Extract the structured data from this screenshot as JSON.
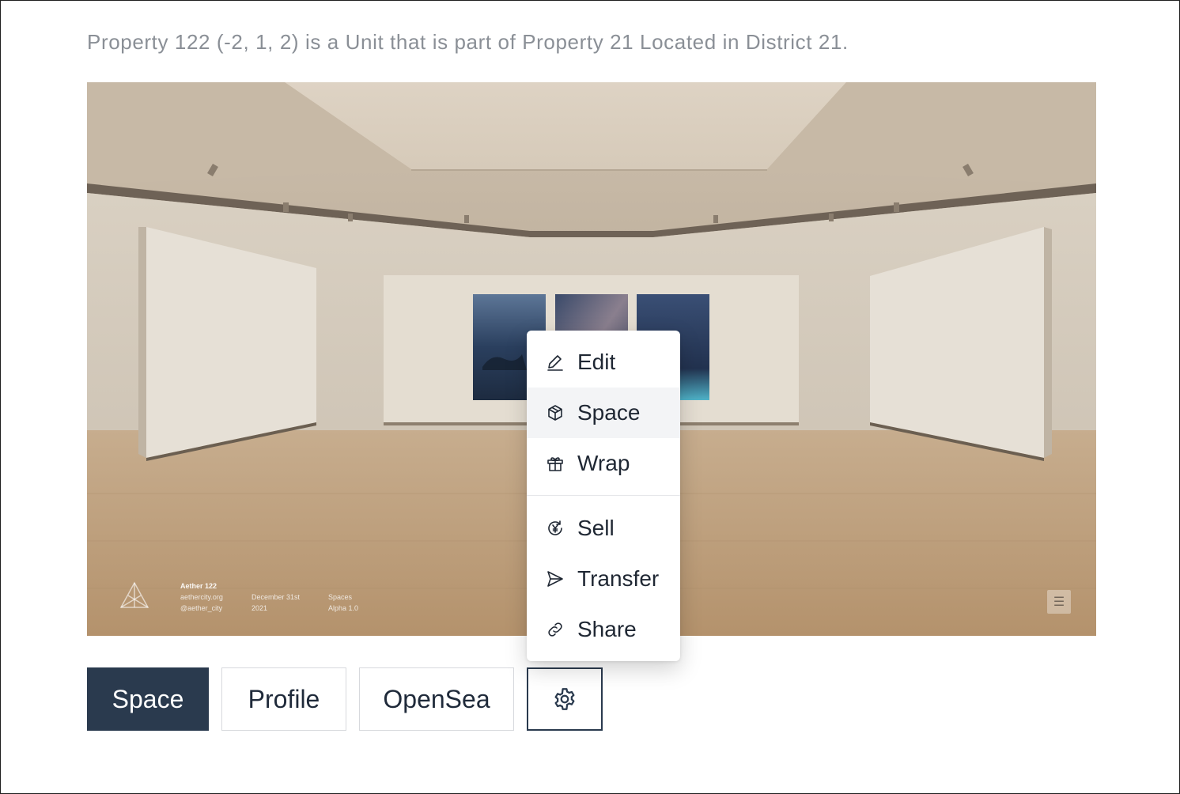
{
  "description": "Property 122 (-2, 1, 2) is a Unit that is part of Property 21 Located in District 21.",
  "viewport": {
    "hud": {
      "col1": [
        "Aether 122",
        "aethercity.org",
        "@aether_city"
      ],
      "col2": [
        "December 31st",
        "2021"
      ],
      "col3": [
        "Spaces",
        "Alpha 1.0"
      ],
      "menu_glyph": "☰"
    }
  },
  "buttons": {
    "space": "Space",
    "profile": "Profile",
    "opensea": "OpenSea"
  },
  "dropdown": {
    "items": [
      {
        "label": "Edit",
        "icon": "pencil-icon"
      },
      {
        "label": "Space",
        "icon": "cube-icon"
      },
      {
        "label": "Wrap",
        "icon": "gift-icon"
      },
      {
        "label": "Sell",
        "icon": "currency-yen-icon"
      },
      {
        "label": "Transfer",
        "icon": "send-icon"
      },
      {
        "label": "Share",
        "icon": "link-icon"
      }
    ]
  },
  "colors": {
    "primary_button": "#2a3a4e",
    "description_text": "#8a8f96"
  }
}
